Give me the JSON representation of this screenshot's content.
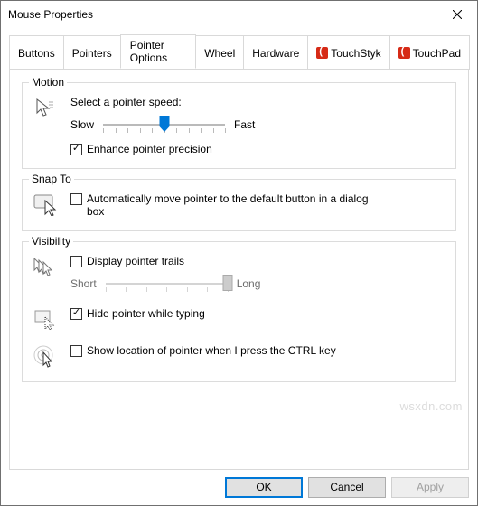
{
  "window": {
    "title": "Mouse Properties"
  },
  "tabs": [
    {
      "label": "Buttons"
    },
    {
      "label": "Pointers"
    },
    {
      "label": "Pointer Options"
    },
    {
      "label": "Wheel"
    },
    {
      "label": "Hardware"
    },
    {
      "label": "TouchStyk"
    },
    {
      "label": "TouchPad"
    }
  ],
  "motion": {
    "title": "Motion",
    "select_speed": "Select a pointer speed:",
    "slow": "Slow",
    "fast": "Fast",
    "enhance": "Enhance pointer precision"
  },
  "snap": {
    "title": "Snap To",
    "auto_move": "Automatically move pointer to the default button in a dialog box"
  },
  "visibility": {
    "title": "Visibility",
    "trails": "Display pointer trails",
    "short": "Short",
    "long": "Long",
    "hide_typing": "Hide pointer while typing",
    "ctrl_locate": "Show location of pointer when I press the CTRL key"
  },
  "buttons": {
    "ok": "OK",
    "cancel": "Cancel",
    "apply": "Apply"
  },
  "watermark": "wsxdn.com"
}
